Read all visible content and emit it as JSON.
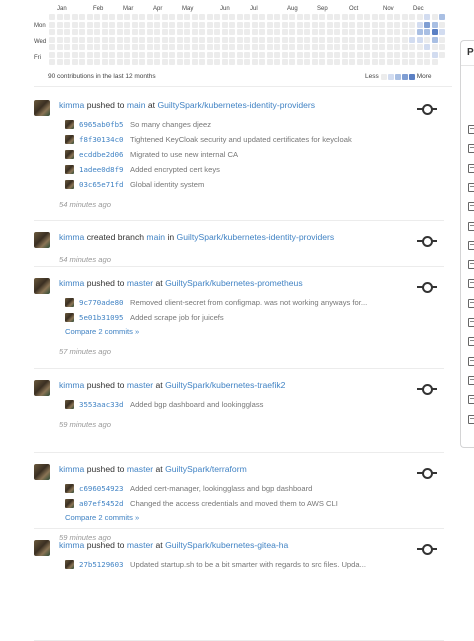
{
  "heatmap": {
    "months": [
      "Jan",
      "Feb",
      "Mar",
      "Apr",
      "May",
      "Jun",
      "Jul",
      "Aug",
      "Sep",
      "Oct",
      "Nov",
      "Dec"
    ],
    "day_labels": [
      "Mon",
      "Wed",
      "Fri"
    ],
    "summary": "90 contributions in the last 12 months",
    "legend_less": "Less",
    "legend_more": "More",
    "colors": [
      "#ececec",
      "#d2dcf0",
      "#a9bfe3",
      "#7f9ed3",
      "#5b80c4"
    ]
  },
  "side_panel": {
    "top_glyph": "P"
  },
  "feed": [
    {
      "user": "kimma",
      "action": "pushed to",
      "ref": "main",
      "prep": "at",
      "repo": "GuiltySpark/kubernetes-identity-providers",
      "commits": [
        {
          "sha": "6965ab0fb5",
          "message": "So many changes djeez"
        },
        {
          "sha": "f8f30134c0",
          "message": "Tightened KeyCloak security and updated certificates for keycloak"
        },
        {
          "sha": "ecddbe2d06",
          "message": "Migrated to use new internal CA"
        },
        {
          "sha": "1adee0d8f9",
          "message": "Added encrypted cert keys"
        },
        {
          "sha": "03c65e71fd",
          "message": "Global identity system"
        }
      ],
      "compare": "",
      "time": "54 minutes ago"
    },
    {
      "user": "kimma",
      "action": "created branch",
      "ref": "main",
      "prep": "in",
      "repo": "GuiltySpark/kubernetes-identity-providers",
      "commits": [],
      "compare": "",
      "time": "54 minutes ago"
    },
    {
      "user": "kimma",
      "action": "pushed to",
      "ref": "master",
      "prep": "at",
      "repo": "GuiltySpark/kubernetes-prometheus",
      "commits": [
        {
          "sha": "9c770ade80",
          "message": "Removed client-secret from configmap. was not working anyways for..."
        },
        {
          "sha": "5e01b31095",
          "message": "Added scrape job for juicefs"
        }
      ],
      "compare": "Compare 2 commits »",
      "time": "57 minutes ago"
    },
    {
      "user": "kimma",
      "action": "pushed to",
      "ref": "master",
      "prep": "at",
      "repo": "GuiltySpark/kubernetes-traefik2",
      "commits": [
        {
          "sha": "3553aac33d",
          "message": "Added bgp dashboard and lookingglass"
        }
      ],
      "compare": "",
      "time": "59 minutes ago"
    },
    {
      "user": "kimma",
      "action": "pushed to",
      "ref": "master",
      "prep": "at",
      "repo": "GuiltySpark/terraform",
      "commits": [
        {
          "sha": "c696054923",
          "message": "Added cert-manager, lookingglass and bgp dashboard"
        },
        {
          "sha": "a07ef5452d",
          "message": "Changed the access credentials and moved them to AWS CLI"
        }
      ],
      "compare": "Compare 2 commits »",
      "time": "59 minutes ago"
    },
    {
      "user": "kimma",
      "action": "pushed to",
      "ref": "master",
      "prep": "at",
      "repo": "GuiltySpark/kubernetes-gitea-ha",
      "commits": [
        {
          "sha": "27b5129603",
          "message": "Updated startup.sh to be a bit smarter with regards to src files. Upda..."
        }
      ],
      "compare": "",
      "time": ""
    }
  ]
}
